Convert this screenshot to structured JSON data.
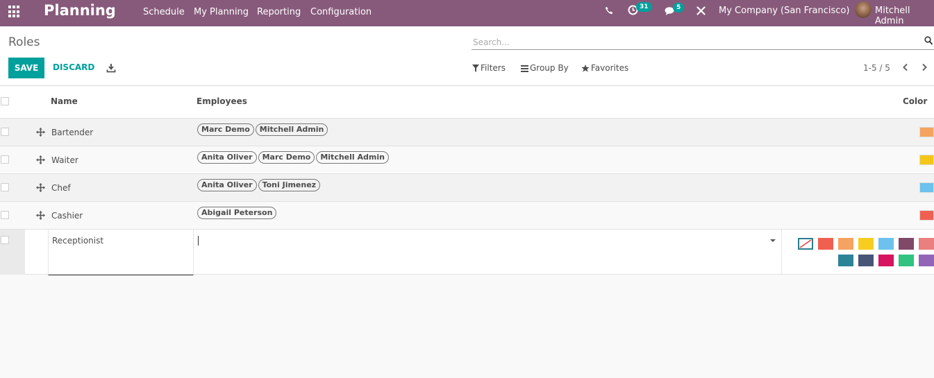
{
  "nav": {
    "brand": "Planning",
    "menu": [
      "Schedule",
      "My Planning",
      "Reporting",
      "Configuration"
    ],
    "activity_count": "31",
    "message_count": "5",
    "company": "My Company (San Francisco)",
    "user": "Mitchell Admin"
  },
  "control": {
    "breadcrumb": "Roles",
    "search_placeholder": "Search...",
    "save_label": "SAVE",
    "discard_label": "DISCARD",
    "filters_label": "Filters",
    "groupby_label": "Group By",
    "favorites_label": "Favorites",
    "pager": "1-5 / 5"
  },
  "table": {
    "columns": {
      "name": "Name",
      "employees": "Employees",
      "color": "Color"
    },
    "rows": [
      {
        "name": "Bartender",
        "employees": [
          "Marc Demo",
          "Mitchell Admin"
        ],
        "color": "#f4a460"
      },
      {
        "name": "Waiter",
        "employees": [
          "Anita Oliver",
          "Marc Demo",
          "Mitchell Admin"
        ],
        "color": "#f5c518"
      },
      {
        "name": "Chef",
        "employees": [
          "Anita Oliver",
          "Toni Jimenez"
        ],
        "color": "#6cc1ed"
      },
      {
        "name": "Cashier",
        "employees": [
          "Abigail Peterson"
        ],
        "color": "#f06050"
      }
    ],
    "edit_row": {
      "name": "Receptionist",
      "palette_row1": [
        "#f06050",
        "#f4a460",
        "#f7cd1f",
        "#6cc1ed",
        "#814968",
        "#eb7e7f"
      ],
      "palette_row2": [
        "#2c8397",
        "#475577",
        "#d6145f",
        "#30c381",
        "#9365b8"
      ]
    }
  },
  "colors": {
    "navbar": "#875a7b",
    "primary": "#00a09d"
  }
}
